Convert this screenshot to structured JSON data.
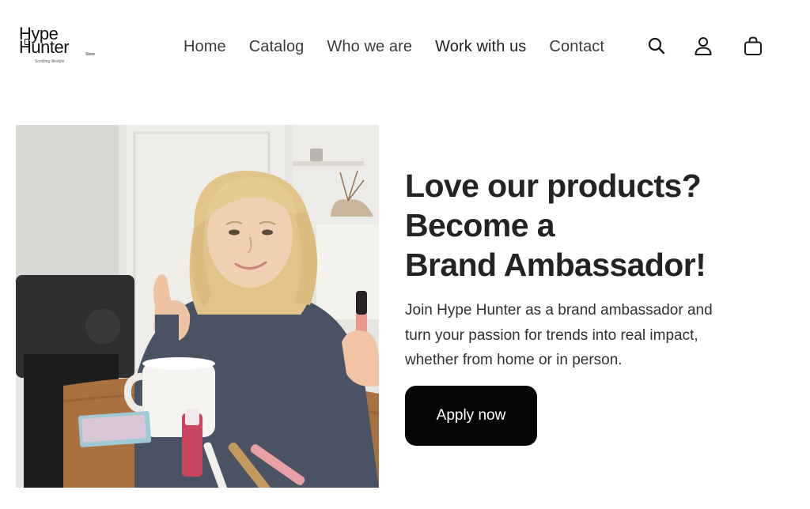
{
  "brand": {
    "line1": "Hype",
    "line2": "Hunter",
    "store": "Store",
    "tagline": "Scrolling lifestyle"
  },
  "nav": {
    "items": [
      {
        "label": "Home"
      },
      {
        "label": "Catalog"
      },
      {
        "label": "Who we are"
      },
      {
        "label": "Work with us"
      },
      {
        "label": "Contact"
      }
    ]
  },
  "header_icons": [
    "search-icon",
    "account-icon",
    "cart-icon"
  ],
  "hero": {
    "title_lines": [
      "Love our products?",
      "Become a",
      "Brand Ambassador!"
    ],
    "description_lines": [
      "Join Hype Hunter as a brand ambassador and",
      "turn your passion for trends into real impact,",
      "whether from home or in person."
    ],
    "cta_label": "Apply now"
  },
  "colors": {
    "text": "#232323",
    "nav_text": "#3b3b3b",
    "button_bg": "#060606",
    "button_text": "#ffffff",
    "background": "#ffffff"
  }
}
